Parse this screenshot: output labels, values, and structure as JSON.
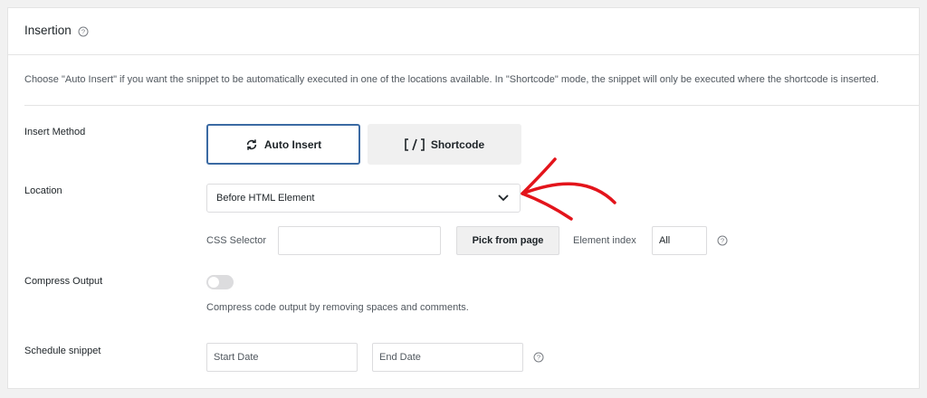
{
  "panel": {
    "title": "Insertion",
    "description": "Choose \"Auto Insert\" if you want the snippet to be automatically executed in one of the locations available. In \"Shortcode\" mode, the snippet will only be executed where the shortcode is inserted."
  },
  "insert_method": {
    "label": "Insert Method",
    "options": [
      {
        "label": "Auto Insert",
        "icon": "refresh-icon",
        "selected": true
      },
      {
        "label": "Shortcode",
        "icon": "shortcode-brackets-icon",
        "selected": false
      }
    ]
  },
  "location": {
    "label": "Location",
    "selected": "Before HTML Element",
    "css_selector_label": "CSS Selector",
    "css_selector_value": "",
    "pick_button": "Pick from page",
    "element_index_label": "Element index",
    "element_index_value": "All"
  },
  "compress_output": {
    "label": "Compress Output",
    "enabled": false,
    "description": "Compress code output by removing spaces and comments."
  },
  "schedule": {
    "label": "Schedule snippet",
    "start_placeholder": "Start Date",
    "end_placeholder": "End Date"
  },
  "colors": {
    "accent": "#3b6aa3",
    "annotation_arrow": "#e3141b"
  }
}
